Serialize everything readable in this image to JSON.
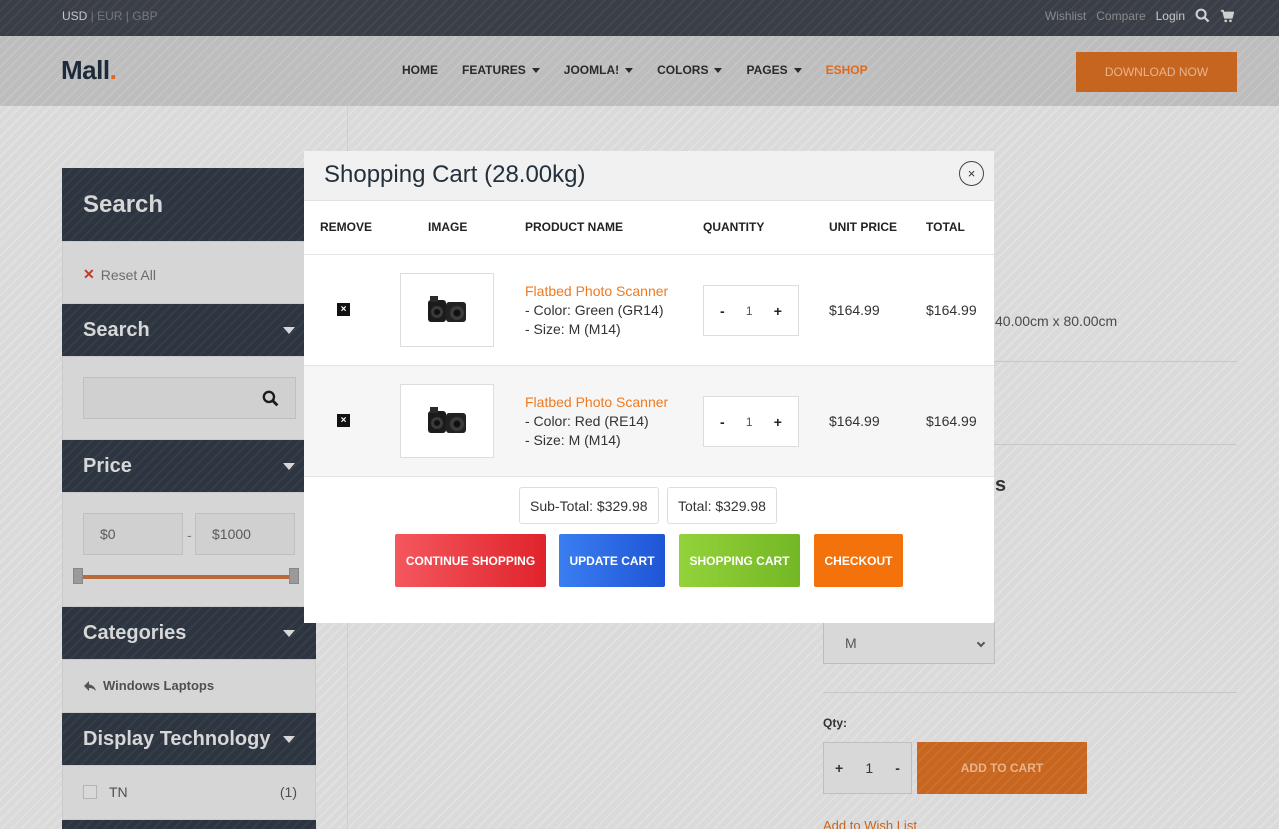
{
  "topbar": {
    "currency_active": "USD",
    "currency_rest": " | EUR | GBP",
    "wishlist": "Wishlist",
    "compare": "Compare",
    "login": "Login"
  },
  "header": {
    "logo": "Mall",
    "logo_dot": ".",
    "nav": [
      "HOME",
      "FEATURES",
      "JOOMLA!",
      "COLORS",
      "PAGES",
      "ESHOP"
    ],
    "download": "DOWNLOAD NOW"
  },
  "sidebar": {
    "search_title": "Search",
    "reset_all": "Reset All",
    "search_section": "Search",
    "price_section": "Price",
    "price_min": "$0",
    "price_max": "$1000",
    "categories_section": "Categories",
    "category_item": "Windows Laptops",
    "display_section": "Display Technology",
    "display_item": "TN",
    "display_count": "(1)"
  },
  "product": {
    "dimensions_fragment": "40.00cm x 80.00cm",
    "heading_fragment": "s",
    "size_selected": "M",
    "qty_label": "Qty:",
    "qty_value": "1",
    "add_to_cart": "ADD TO CART",
    "add_to_wishlist": "Add to Wish List"
  },
  "cart": {
    "title": "Shopping Cart  (28.00kg)",
    "columns": {
      "remove": "REMOVE",
      "image": "IMAGE",
      "product_name": "PRODUCT NAME",
      "quantity": "QUANTITY",
      "unit_price": "UNIT PRICE",
      "total": "TOTAL"
    },
    "rows": [
      {
        "name": "Flatbed Photo Scanner",
        "color": "- Color: Green (GR14)",
        "size": "- Size: M (M14)",
        "qty": "1",
        "unit_price": "$164.99",
        "total": "$164.99"
      },
      {
        "name": "Flatbed Photo Scanner",
        "color": "- Color: Red (RE14)",
        "size": "- Size: M (M14)",
        "qty": "1",
        "unit_price": "$164.99",
        "total": "$164.99"
      }
    ],
    "subtotal": "Sub-Total: $329.98",
    "total": "Total: $329.98",
    "buttons": {
      "continue": "CONTINUE SHOPPING",
      "update": "UPDATE CART",
      "shopping_cart": "SHOPPING CART",
      "checkout": "CHECKOUT"
    },
    "qty_minus": "-",
    "qty_plus": "+",
    "remove_glyph": "×",
    "close_glyph": "×"
  },
  "colors": {
    "accent": "#ee7a21",
    "dark": "#2d3541",
    "continue_red": "#e0232b",
    "update_blue": "#1f55d6",
    "cart_green": "#74b725",
    "checkout_orange": "#f4720c"
  }
}
